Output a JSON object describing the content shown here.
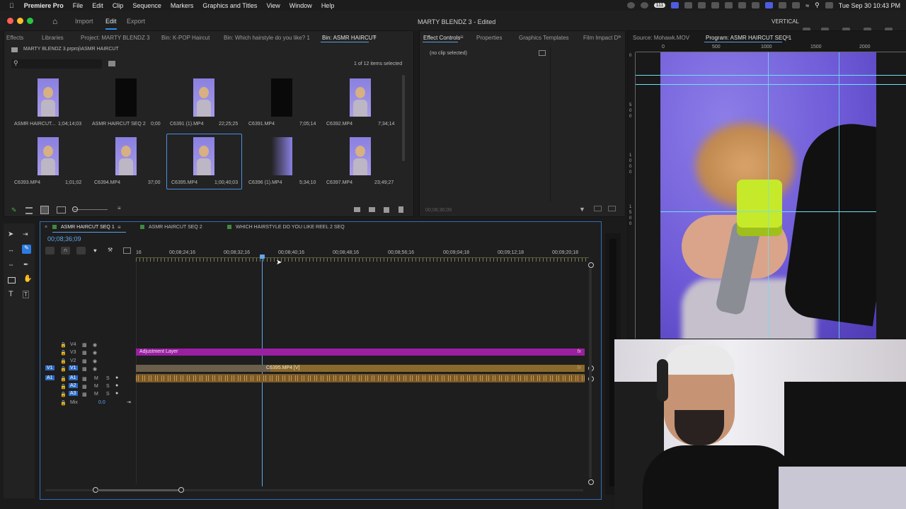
{
  "menubar": {
    "app": "Premiere Pro",
    "items": [
      "File",
      "Edit",
      "Clip",
      "Sequence",
      "Markers",
      "Graphics and Titles",
      "View",
      "Window",
      "Help"
    ],
    "clock": "Tue Sep 30  10:43 PM",
    "battery": "111"
  },
  "titlebar": {
    "workspaces": [
      "Import",
      "Edit",
      "Export"
    ],
    "active_workspace": "Edit",
    "document": "MARTY BLENDZ 3 - Edited",
    "layout_label": "VERTICAL"
  },
  "project_panel": {
    "tabs": [
      "Effects",
      "Libraries",
      "Project: MARTY BLENDZ 3",
      "Bin: K-POP Haircut",
      "Bin: Which hairstyle do you like? 1",
      "Bin: ASMR HAIRCUT"
    ],
    "active_tab": "Bin: ASMR HAIRCUT",
    "path": "MARTY BLENDZ 3.prproj\\ASMR HAIRCUT",
    "search_placeholder": "",
    "selection_count": "1 of 12 items selected",
    "items": [
      {
        "name": "ASMR HAIRCUT...",
        "duration": "1;04;14;03"
      },
      {
        "name": "ASMR HAIRCUT SEQ 2",
        "duration": "0;00"
      },
      {
        "name": "C6391 (1).MP4",
        "duration": "22;25;25"
      },
      {
        "name": "C6391.MP4",
        "duration": "7;05;14"
      },
      {
        "name": "C6392.MP4",
        "duration": "7;34;14"
      },
      {
        "name": "C6393.MP4",
        "duration": "1;01;02"
      },
      {
        "name": "C6394.MP4",
        "duration": "37;00"
      },
      {
        "name": "C6395.MP4",
        "duration": "1;00;40;03"
      },
      {
        "name": "C6396 (1).MP4",
        "duration": "5;34;10"
      },
      {
        "name": "C6397.MP4",
        "duration": "23;49;27"
      }
    ]
  },
  "effect_panel": {
    "tabs": [
      "Effect Controls",
      "Properties",
      "Graphics Templates",
      "Film Impact D"
    ],
    "active_tab": "Effect Controls",
    "no_clip": "(no clip selected)",
    "timecode": "00;08;36;09"
  },
  "program_panel": {
    "tabs": [
      "Source: Mohawk.MOV",
      "Program: ASMR HAIRCUT SEQ 1"
    ],
    "active_tab": "Program: ASMR HAIRCUT SEQ 1",
    "ruler": [
      "0",
      "500",
      "1000",
      "1500",
      "2000"
    ],
    "vruler_digits": [
      "0",
      "5",
      "0",
      "0",
      "1",
      "0",
      "0",
      "0",
      "1",
      "5",
      "0",
      "0"
    ]
  },
  "timeline": {
    "tabs": [
      "ASMR HAIRCUT SEQ 1",
      "ASMR HAIRCUT SEQ 2",
      "WHICH HAIRSTYLE DO YOU LIKE REEL 2 SEQ"
    ],
    "tab_colors": [
      "#3e8a3c",
      "#3e8a3c",
      "#3e8a3c"
    ],
    "active_tab": "ASMR HAIRCUT SEQ 1",
    "playhead": "00;08;36;09",
    "ruler_labels": [
      "16",
      "00;08;24;16",
      "00;08;32;16",
      "00;08;40;16",
      "00;08;48;16",
      "00;08;56;16",
      "00;09;04;18",
      "00;09;12;18",
      "00;09;20;18"
    ],
    "video_tracks": [
      "V4",
      "V3",
      "V2",
      "V1"
    ],
    "audio_tracks": [
      "A1",
      "A2",
      "A3"
    ],
    "mix_label": "Mix",
    "mix_value": "0.0",
    "adjustment_clip": "Adjustment Layer",
    "video_clip": "C6395.MP4 [V]",
    "fx_badge": "fx",
    "source_patch_v": "V1",
    "source_patch_a": "A1",
    "mute": "M",
    "solo": "S"
  },
  "colors": {
    "accent": "#2d8ceb",
    "adjustment": "#9b1fa2",
    "video_clip": "#8a6a2c",
    "audio_clip": "#a5742e",
    "background": "#1b1b1b"
  }
}
